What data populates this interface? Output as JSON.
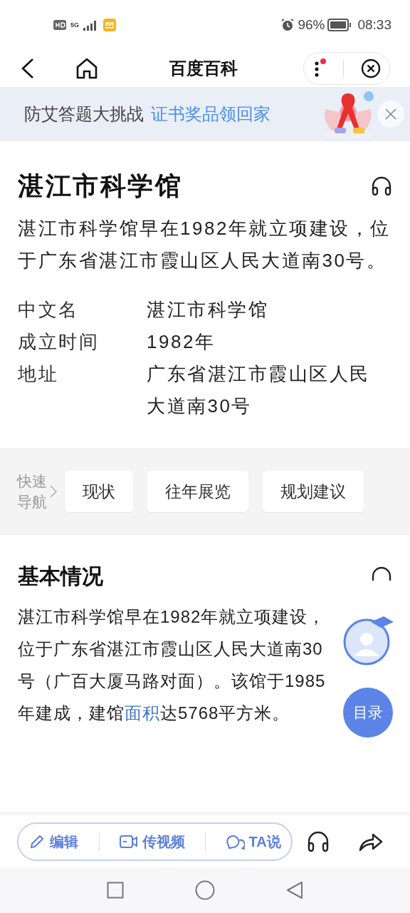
{
  "status_bar": {
    "network": "5G",
    "battery": "96%",
    "time": "08:33"
  },
  "nav": {
    "title": "百度百科"
  },
  "banner": {
    "text": "防艾答题大挑战",
    "highlight": "证书奖品领回家"
  },
  "entry": {
    "title": "湛江市科学馆",
    "summary": "湛江市科学馆早在1982年就立项建设，位于广东省湛江市霞山区人民大道南30号。",
    "info": [
      {
        "label": "中文名",
        "value": "湛江市科学馆"
      },
      {
        "label": "成立时间",
        "value": "1982年"
      },
      {
        "label": "地址",
        "value": "广东省湛江市霞山区人民大道南30号"
      }
    ]
  },
  "quick_nav": {
    "label": "快速导航",
    "items": [
      "现状",
      "往年展览",
      "规划建议"
    ]
  },
  "section": {
    "title": "基本情况",
    "parts": [
      {
        "kind": "plain",
        "text": "湛江市科学馆早在1982年就立项建设，位于广东省湛江市霞山区人民大道南30号（广百大厦马路对面）。该馆于1985年建成，建馆"
      },
      {
        "kind": "link",
        "text": "面积"
      },
      {
        "kind": "plain",
        "text": "达5768平方米。"
      }
    ]
  },
  "toc_button": "目录",
  "bottom_bar": {
    "actions": [
      {
        "kind": "edit",
        "label": "编辑"
      },
      {
        "kind": "video",
        "label": "传视频"
      },
      {
        "kind": "comment",
        "label": "TA说"
      }
    ]
  }
}
